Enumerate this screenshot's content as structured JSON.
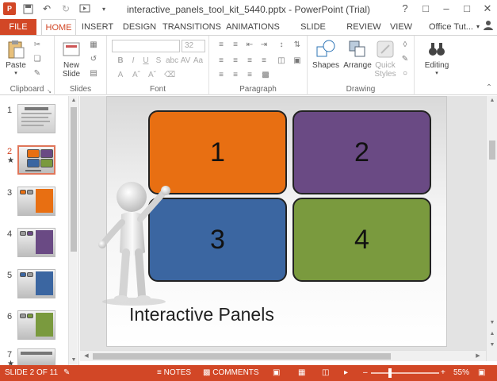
{
  "window": {
    "title": "interactive_panels_tool_kit_5440.pptx - PowerPoint (Trial)",
    "controls": [
      "?",
      "□",
      "–",
      "□",
      "✕"
    ]
  },
  "tabs": [
    "FILE",
    "HOME",
    "INSERT",
    "DESIGN",
    "TRANSITIONS",
    "ANIMATIONS",
    "SLIDE SHOW",
    "REVIEW",
    "VIEW"
  ],
  "active_tab": "HOME",
  "account": "Office Tut...",
  "ribbon": {
    "clipboard": {
      "paste": "Paste",
      "label": "Clipboard"
    },
    "slides": {
      "new_slide": "New",
      "new_slide2": "Slide",
      "label": "Slides"
    },
    "font": {
      "font_size": "32",
      "label": "Font"
    },
    "paragraph": {
      "label": "Paragraph"
    },
    "drawing": {
      "shapes": "Shapes",
      "arrange": "Arrange",
      "quick_styles": "Quick",
      "quick_styles2": "Styles",
      "label": "Drawing"
    },
    "editing": {
      "label": "Editing"
    }
  },
  "thumbnails": [
    {
      "num": "1",
      "star": ""
    },
    {
      "num": "2",
      "star": "★"
    },
    {
      "num": "3",
      "star": ""
    },
    {
      "num": "4",
      "star": ""
    },
    {
      "num": "5",
      "star": ""
    },
    {
      "num": "6",
      "star": ""
    },
    {
      "num": "7",
      "star": "★"
    }
  ],
  "slide": {
    "panels": [
      {
        "label": "1",
        "color": "#e86f12"
      },
      {
        "label": "2",
        "color": "#6a4a84"
      },
      {
        "label": "3",
        "color": "#3b66a1"
      },
      {
        "label": "4",
        "color": "#7a9a3e"
      }
    ],
    "caption": "Interactive Panels"
  },
  "status": {
    "slide_info": "SLIDE 2 OF 11",
    "notes": "NOTES",
    "comments": "COMMENTS",
    "zoom_minus": "–",
    "zoom_plus": "+",
    "zoom": "55%"
  },
  "colors": {
    "accent": "#d24726"
  }
}
